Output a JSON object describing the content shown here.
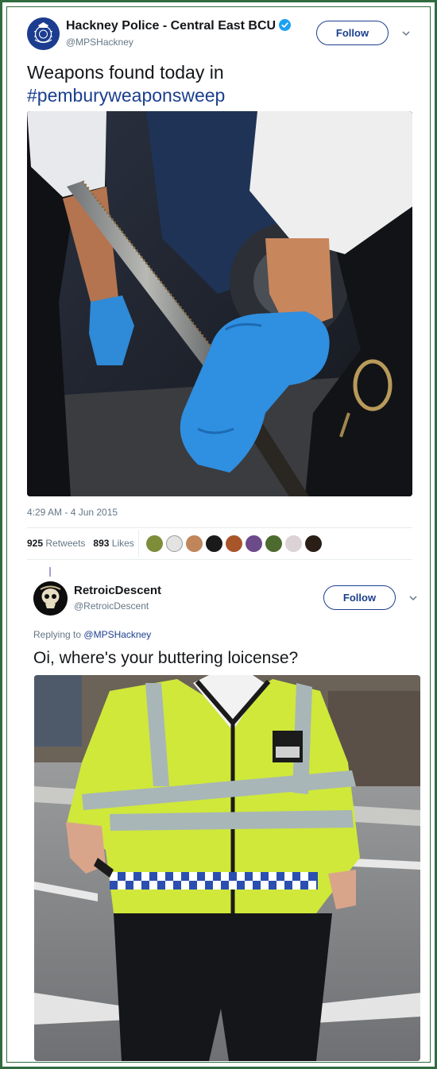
{
  "tweet1": {
    "author_name": "Hackney Police - Central East BCU",
    "handle": "@MPSHackney",
    "follow_label": "Follow",
    "text_line1": "Weapons found today in",
    "hashtag": "#pemburyweaponsweep",
    "timestamp": "4:29 AM - 4 Jun 2015",
    "retweets_count": "925",
    "retweets_label": "Retweets",
    "likes_count": "893",
    "likes_label": "Likes",
    "likers": 9,
    "colors": {
      "accent": "#1b3f8f",
      "verified": "#1da1f2",
      "avatar_bg": "#1c3d8f"
    }
  },
  "tweet2": {
    "author_name": "RetroicDescent",
    "handle": "@RetroicDescent",
    "follow_label": "Follow",
    "replying_prefix": "Replying to",
    "replying_handle": "@MPSHackney",
    "text": "Oi, where's your buttering loicense?",
    "colors": {
      "thread_line": "#a99cdb"
    }
  },
  "frame": {
    "border_color": "#2f6b3f"
  }
}
